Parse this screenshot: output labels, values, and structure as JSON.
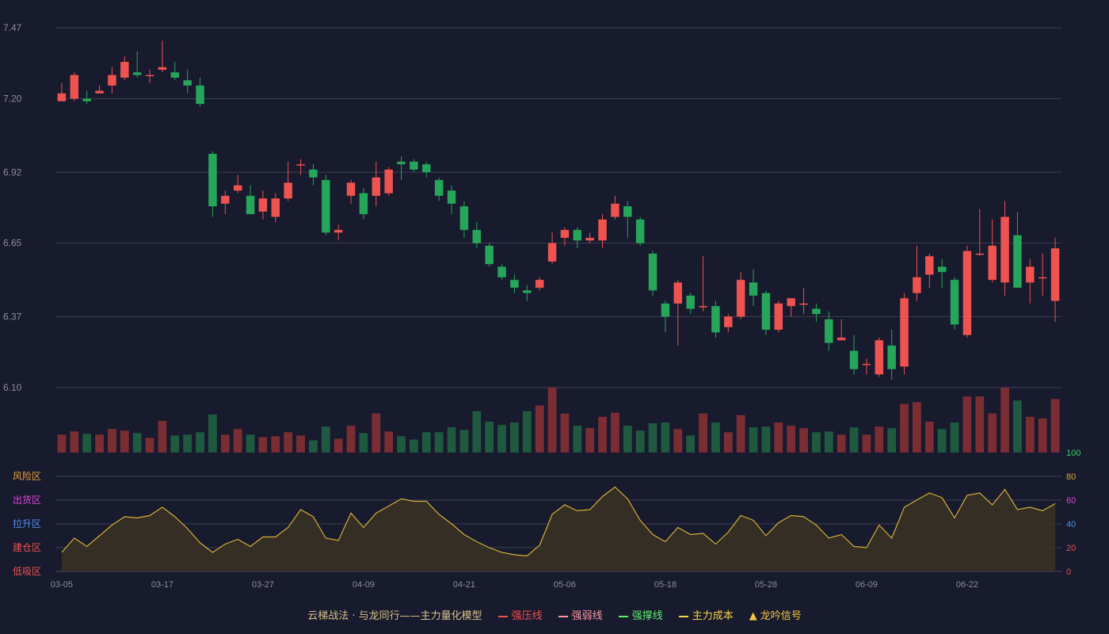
{
  "chart_data": {
    "type": "candlestick",
    "dates": [
      "03-05",
      "03-06",
      "03-07",
      "03-10",
      "03-11",
      "03-12",
      "03-13",
      "03-14",
      "03-17",
      "03-18",
      "03-19",
      "03-20",
      "03-21",
      "03-24",
      "03-25",
      "03-26",
      "03-27",
      "03-28",
      "03-31",
      "04-01",
      "04-02",
      "04-03",
      "04-07",
      "04-08",
      "04-09",
      "04-10",
      "04-11",
      "04-14",
      "04-15",
      "04-16",
      "04-17",
      "04-18",
      "04-21",
      "04-22",
      "04-23",
      "04-24",
      "04-25",
      "04-28",
      "04-29",
      "04-30",
      "05-06",
      "05-07",
      "05-08",
      "05-09",
      "05-12",
      "05-13",
      "05-14",
      "05-15",
      "05-16",
      "05-18",
      "05-19",
      "05-20",
      "05-21",
      "05-22",
      "05-23",
      "05-26",
      "05-27",
      "05-28",
      "05-29",
      "05-30",
      "06-03",
      "06-04",
      "06-05",
      "06-06",
      "06-09",
      "06-10",
      "06-11",
      "06-12",
      "06-13",
      "06-16",
      "06-17",
      "06-18",
      "06-19",
      "06-20",
      "06-22",
      "06-23",
      "06-24",
      "06-25",
      "06-26",
      "06-27"
    ],
    "ohlc": [
      [
        7.19,
        7.22,
        7.26,
        7.2
      ],
      [
        7.2,
        7.29,
        7.3,
        7.19
      ],
      [
        7.2,
        7.19,
        7.23,
        7.18
      ],
      [
        7.22,
        7.23,
        7.25,
        7.22
      ],
      [
        7.25,
        7.29,
        7.32,
        7.22
      ],
      [
        7.28,
        7.34,
        7.36,
        7.27
      ],
      [
        7.3,
        7.29,
        7.38,
        7.28
      ],
      [
        7.29,
        7.29,
        7.31,
        7.26
      ],
      [
        7.31,
        7.32,
        7.42,
        7.3
      ],
      [
        7.3,
        7.28,
        7.34,
        7.27
      ],
      [
        7.27,
        7.25,
        7.31,
        7.22
      ],
      [
        7.25,
        7.18,
        7.28,
        7.17
      ],
      [
        6.99,
        6.79,
        7.0,
        6.75
      ],
      [
        6.8,
        6.83,
        6.85,
        6.76
      ],
      [
        6.85,
        6.87,
        6.91,
        6.84
      ],
      [
        6.83,
        6.76,
        6.87,
        6.78
      ],
      [
        6.77,
        6.82,
        6.85,
        6.74
      ],
      [
        6.75,
        6.82,
        6.84,
        6.73
      ],
      [
        6.82,
        6.88,
        6.96,
        6.81
      ],
      [
        6.95,
        6.95,
        6.97,
        6.91
      ],
      [
        6.93,
        6.9,
        6.95,
        6.87
      ],
      [
        6.89,
        6.69,
        6.91,
        6.68
      ],
      [
        6.69,
        6.7,
        6.72,
        6.66
      ],
      [
        6.83,
        6.88,
        6.89,
        6.8
      ],
      [
        6.84,
        6.76,
        6.86,
        6.74
      ],
      [
        6.83,
        6.9,
        6.96,
        6.79
      ],
      [
        6.84,
        6.93,
        6.94,
        6.83
      ],
      [
        6.96,
        6.95,
        6.98,
        6.89
      ],
      [
        6.96,
        6.93,
        6.97,
        6.92
      ],
      [
        6.95,
        6.92,
        6.96,
        6.9
      ],
      [
        6.89,
        6.83,
        6.9,
        6.81
      ],
      [
        6.85,
        6.8,
        6.87,
        6.76
      ],
      [
        6.79,
        6.7,
        6.81,
        6.67
      ],
      [
        6.7,
        6.65,
        6.73,
        6.63
      ],
      [
        6.64,
        6.57,
        6.65,
        6.56
      ],
      [
        6.56,
        6.52,
        6.57,
        6.51
      ],
      [
        6.51,
        6.48,
        6.53,
        6.46
      ],
      [
        6.47,
        6.46,
        6.49,
        6.43
      ],
      [
        6.48,
        6.51,
        6.52,
        6.47
      ],
      [
        6.58,
        6.65,
        6.69,
        6.57
      ],
      [
        6.67,
        6.7,
        6.71,
        6.64
      ],
      [
        6.7,
        6.66,
        6.71,
        6.63
      ],
      [
        6.66,
        6.67,
        6.69,
        6.65
      ],
      [
        6.66,
        6.74,
        6.76,
        6.63
      ],
      [
        6.75,
        6.8,
        6.83,
        6.74
      ],
      [
        6.79,
        6.75,
        6.81,
        6.67
      ],
      [
        6.74,
        6.65,
        6.75,
        6.64
      ],
      [
        6.61,
        6.47,
        6.62,
        6.45
      ],
      [
        6.42,
        6.37,
        6.43,
        6.31
      ],
      [
        6.42,
        6.5,
        6.51,
        6.26
      ],
      [
        6.45,
        6.4,
        6.46,
        6.38
      ],
      [
        6.41,
        6.41,
        6.6,
        6.39
      ],
      [
        6.41,
        6.31,
        6.43,
        6.29
      ],
      [
        6.33,
        6.37,
        6.38,
        6.31
      ],
      [
        6.37,
        6.51,
        6.54,
        6.36
      ],
      [
        6.5,
        6.45,
        6.55,
        6.41
      ],
      [
        6.46,
        6.32,
        6.47,
        6.3
      ],
      [
        6.32,
        6.42,
        6.43,
        6.31
      ],
      [
        6.41,
        6.44,
        6.44,
        6.37
      ],
      [
        6.42,
        6.42,
        6.48,
        6.38
      ],
      [
        6.4,
        6.38,
        6.42,
        6.35
      ],
      [
        6.36,
        6.27,
        6.39,
        6.24
      ],
      [
        6.28,
        6.29,
        6.36,
        6.28
      ],
      [
        6.24,
        6.17,
        6.3,
        6.15
      ],
      [
        6.19,
        6.19,
        6.21,
        6.15
      ],
      [
        6.15,
        6.28,
        6.29,
        6.14
      ],
      [
        6.26,
        6.17,
        6.32,
        6.13
      ],
      [
        6.18,
        6.44,
        6.46,
        6.15
      ],
      [
        6.46,
        6.52,
        6.64,
        6.43
      ],
      [
        6.53,
        6.6,
        6.61,
        6.48
      ],
      [
        6.56,
        6.54,
        6.59,
        6.48
      ],
      [
        6.51,
        6.34,
        6.52,
        6.32
      ],
      [
        6.3,
        6.62,
        6.64,
        6.29
      ],
      [
        6.61,
        6.61,
        6.78,
        6.6
      ],
      [
        6.51,
        6.64,
        6.74,
        6.5
      ],
      [
        6.5,
        6.75,
        6.81,
        6.45
      ],
      [
        6.68,
        6.48,
        6.77,
        6.48
      ],
      [
        6.5,
        6.56,
        6.59,
        6.42
      ],
      [
        6.52,
        6.52,
        6.61,
        6.45
      ],
      [
        6.43,
        6.63,
        6.67,
        6.35
      ]
    ],
    "volume": [
      22,
      26,
      23,
      22,
      29,
      27,
      24,
      18,
      39,
      21,
      22,
      25,
      47,
      22,
      29,
      22,
      19,
      20,
      25,
      21,
      15,
      32,
      17,
      33,
      24,
      48,
      26,
      20,
      16,
      25,
      25,
      31,
      28,
      51,
      38,
      34,
      37,
      51,
      58,
      80,
      48,
      33,
      30,
      44,
      49,
      33,
      27,
      36,
      37,
      29,
      21,
      48,
      37,
      25,
      46,
      31,
      32,
      37,
      33,
      30,
      25,
      26,
      22,
      31,
      22,
      32,
      30,
      60,
      62,
      38,
      29,
      37,
      69,
      69,
      48,
      80,
      64,
      44,
      42,
      66
    ],
    "price_ticks": [
      7.47,
      7.2,
      6.92,
      6.65,
      6.37,
      6.1
    ],
    "ylim": [
      6.1,
      7.47
    ],
    "x_ticks": [
      {
        "i": 0,
        "label": "03-05"
      },
      {
        "i": 8,
        "label": "03-17"
      },
      {
        "i": 16,
        "label": "03-27"
      },
      {
        "i": 24,
        "label": "04-09"
      },
      {
        "i": 32,
        "label": "04-21"
      },
      {
        "i": 40,
        "label": "05-06"
      },
      {
        "i": 48,
        "label": "05-18"
      },
      {
        "i": 56,
        "label": "05-28"
      },
      {
        "i": 64,
        "label": "06-09"
      },
      {
        "i": 72,
        "label": "06-22"
      }
    ],
    "indicator": {
      "values": [
        16,
        28,
        21,
        30,
        39,
        46,
        45,
        47,
        54,
        46,
        36,
        24,
        16,
        23,
        27,
        21,
        29,
        29,
        37,
        52,
        46,
        28,
        26,
        49,
        37,
        49,
        55,
        61,
        59,
        59,
        48,
        40,
        31,
        25,
        20,
        16,
        14,
        13,
        22,
        48,
        56,
        51,
        52,
        63,
        71,
        61,
        43,
        31,
        25,
        37,
        31,
        32,
        23,
        33,
        47,
        43,
        30,
        41,
        47,
        46,
        39,
        28,
        31,
        21,
        20,
        39,
        28,
        54,
        60,
        66,
        62,
        45,
        64,
        66,
        56,
        69,
        52,
        54,
        51,
        57
      ],
      "ylim": [
        0,
        100
      ],
      "ticks": [
        {
          "value": 100,
          "label": "100",
          "color": "#38d66b"
        },
        {
          "value": 80,
          "label": "80",
          "color": "#e8a23a"
        },
        {
          "value": 60,
          "label": "60",
          "color": "#d946d9"
        },
        {
          "value": 40,
          "label": "40",
          "color": "#4f8ff0"
        },
        {
          "value": 20,
          "label": "20",
          "color": "#ef5250"
        },
        {
          "value": 0,
          "label": "0",
          "color": "#ef5250"
        }
      ],
      "zones": [
        {
          "value": 80,
          "label": "风险区",
          "color": "#e8a23a"
        },
        {
          "value": 60,
          "label": "出货区",
          "color": "#d946d9"
        },
        {
          "value": 40,
          "label": "拉升区",
          "color": "#4f8ff0"
        },
        {
          "value": 20,
          "label": "建仓区",
          "color": "#ef5250"
        },
        {
          "value": 0,
          "label": "低吸区",
          "color": "#ef5250"
        }
      ]
    },
    "legend": [
      {
        "label": "云梯战法 · 与龙同行——主力量化模型",
        "color": "#d9c28a",
        "style": "none"
      },
      {
        "label": "强压线",
        "color": "#ef5350",
        "style": "solid"
      },
      {
        "label": "强弱线",
        "color": "#ff9aa6",
        "style": "dashed"
      },
      {
        "label": "强撑线",
        "color": "#5cf06e",
        "style": "solid"
      },
      {
        "label": "主力成本",
        "color": "#f5d547",
        "style": "dashed"
      },
      {
        "label": "龙吟信号",
        "color": "#f5c542",
        "style": "triangle"
      }
    ],
    "colors": {
      "up": "#ef5350",
      "down": "#26a65b",
      "grid": "#3b3e52",
      "line": "#d4af37",
      "area": "#3a3224"
    }
  }
}
